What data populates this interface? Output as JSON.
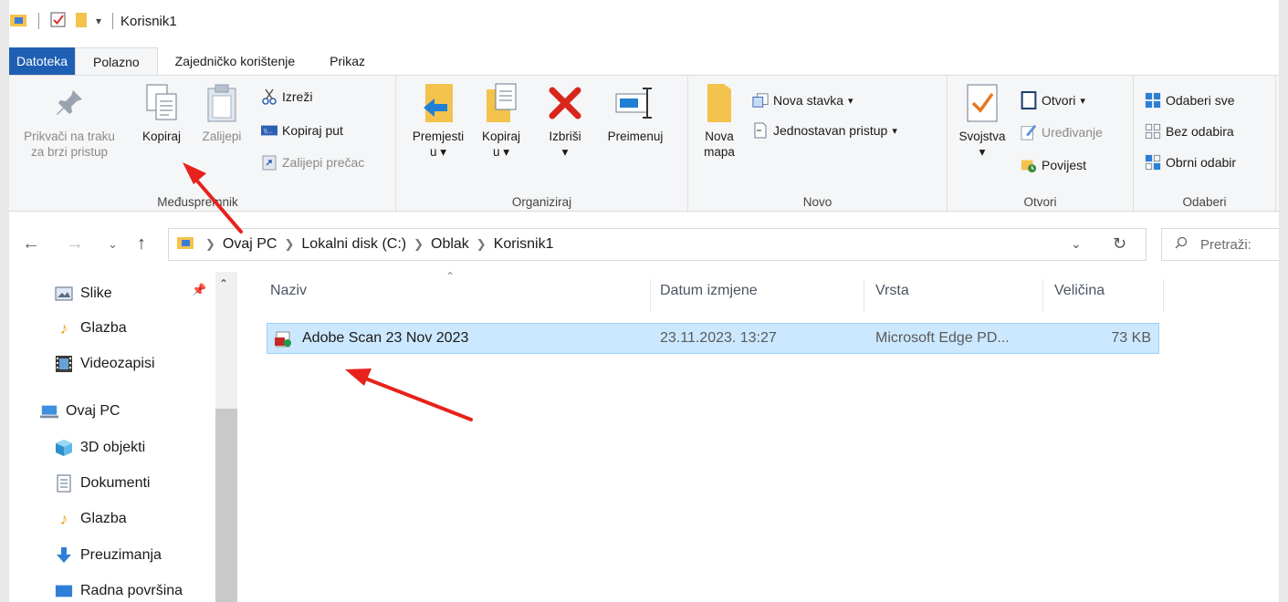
{
  "title": "Korisnik1",
  "tabs": [
    {
      "label": "Datoteka"
    },
    {
      "label": "Polazno"
    },
    {
      "label": "Zajedničko korištenje"
    },
    {
      "label": "Prikaz"
    }
  ],
  "ribbon": {
    "clipboard": {
      "label": "Međuspremnik",
      "pin": "Prikvači na traku za brzi pristup",
      "pin_line1": "Prikvači na traku",
      "pin_line2": "za brzi pristup",
      "copy": "Kopiraj",
      "paste": "Zalijepi",
      "cut": "Izreži",
      "copy_path": "Kopiraj put",
      "paste_shortcut": "Zalijepi prečac"
    },
    "organize": {
      "label": "Organiziraj",
      "move_line1": "Premjesti",
      "move_line2": "u",
      "copy_line1": "Kopiraj",
      "copy_line2": "u",
      "delete": "Izbriši",
      "rename": "Preimenuj"
    },
    "new": {
      "label": "Novo",
      "folder_line1": "Nova",
      "folder_line2": "mapa",
      "new_item": "Nova stavka",
      "easy_access": "Jednostavan pristup"
    },
    "open": {
      "label": "Otvori",
      "properties": "Svojstva",
      "open": "Otvori",
      "edit": "Uređivanje",
      "history": "Povijest"
    },
    "select": {
      "label": "Odaberi",
      "select_all": "Odaberi sve",
      "select_none": "Bez odabira",
      "invert": "Obrni odabir"
    }
  },
  "address": {
    "crumbs": [
      "Ovaj PC",
      "Lokalni disk (C:)",
      "Oblak",
      "Korisnik1"
    ],
    "search_placeholder": "Pretraži:"
  },
  "sidebar": {
    "items": [
      {
        "label": "Slike",
        "icon": "pictures-icon"
      },
      {
        "label": "Glazba",
        "icon": "music-icon"
      },
      {
        "label": "Videozapisi",
        "icon": "videos-icon"
      },
      {
        "label": "Ovaj PC",
        "icon": "pc-icon"
      },
      {
        "label": "3D objekti",
        "icon": "3d-objects-icon"
      },
      {
        "label": "Dokumenti",
        "icon": "documents-icon"
      },
      {
        "label": "Glazba",
        "icon": "music-icon"
      },
      {
        "label": "Preuzimanja",
        "icon": "downloads-icon"
      },
      {
        "label": "Radna površina",
        "icon": "desktop-icon"
      }
    ]
  },
  "files": {
    "columns": [
      "Naziv",
      "Datum izmjene",
      "Vrsta",
      "Veličina"
    ],
    "rows": [
      {
        "name": "Adobe Scan 23 Nov 2023",
        "date": "23.11.2023. 13:27",
        "type": "Microsoft Edge PD...",
        "size": "73 KB"
      }
    ]
  },
  "colors": {
    "accent": "#1f5fb3",
    "selection": "#cce8ff",
    "annotation": "#e8211c"
  }
}
